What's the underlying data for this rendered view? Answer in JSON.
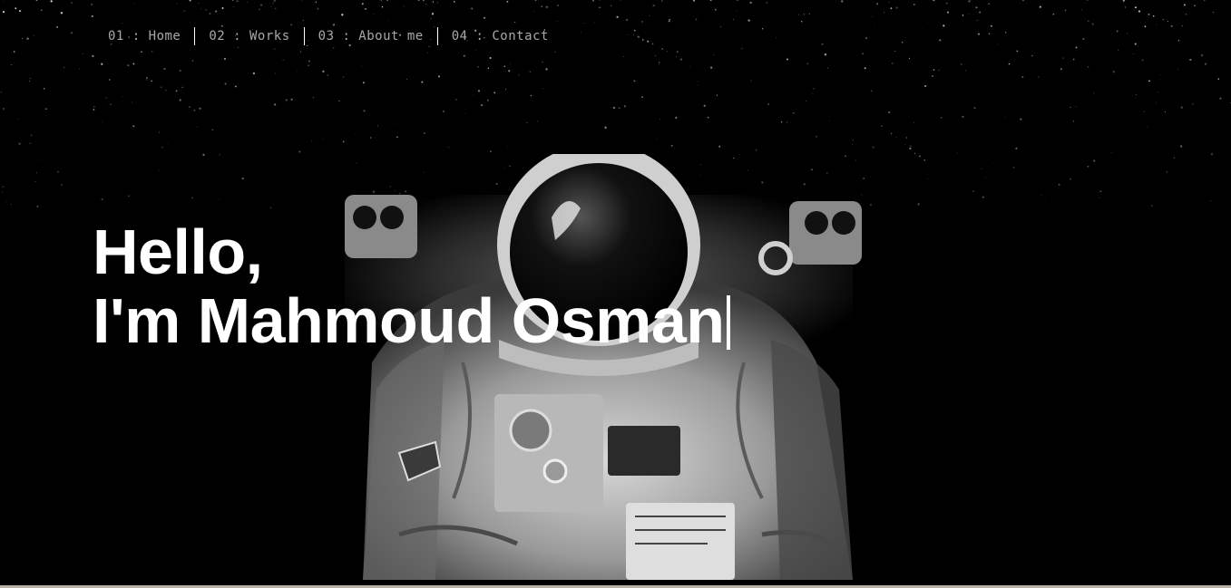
{
  "nav": {
    "items": [
      {
        "label": "01 : Home"
      },
      {
        "label": "02 : Works"
      },
      {
        "label": "03 : About me"
      },
      {
        "label": "04 : Contact"
      }
    ]
  },
  "hero": {
    "line1": "Hello,",
    "line2": "I'm Mahmoud Osman"
  },
  "colors": {
    "background": "#000000",
    "text": "#ffffff",
    "nav_text": "#a9a9a9"
  }
}
